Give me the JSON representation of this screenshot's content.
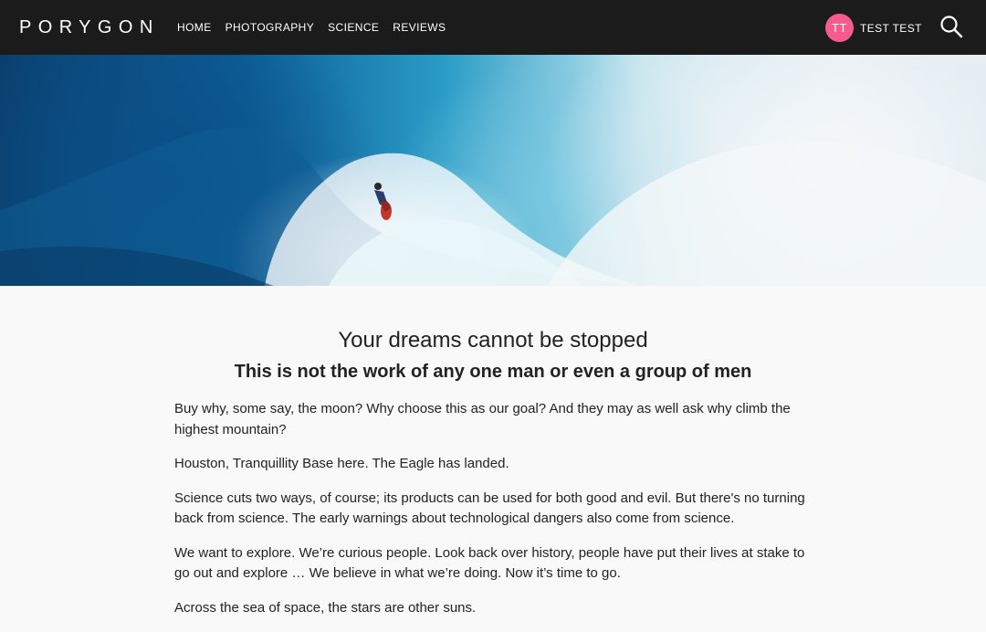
{
  "nav": {
    "logo": "PORYGON",
    "links": [
      "HOME",
      "PHOTOGRAPHY",
      "SCIENCE",
      "REVIEWS"
    ],
    "user": {
      "initials": "TT",
      "name": "TEST TEST"
    },
    "icons": {
      "search": "search-icon"
    }
  },
  "hero": {
    "image": "surfer-on-large-wave-photo"
  },
  "article": {
    "title": "Your dreams cannot be stopped",
    "subtitle": "This is not the work of any one man or even a group of men",
    "paragraphs": [
      "Buy why, some say, the moon? Why choose this as our goal? And they may as well ask why climb the highest mountain?",
      "Houston, Tranquillity Base here. The Eagle has landed.",
      "Science cuts two ways, of course; its products can be used for both good and evil. But there's no turning back from science. The early warnings about technological dangers also come from science.",
      "We want to explore. We’re curious people. Look back over history, people have put their lives at stake to go out and explore … We believe in what we’re doing. Now it’s time to go.",
      "Across the sea of space, the stars are other suns."
    ]
  },
  "colors": {
    "navbar": "#1b1b1b",
    "avatar": "#f55b8f",
    "background": "#f9f9f9"
  }
}
